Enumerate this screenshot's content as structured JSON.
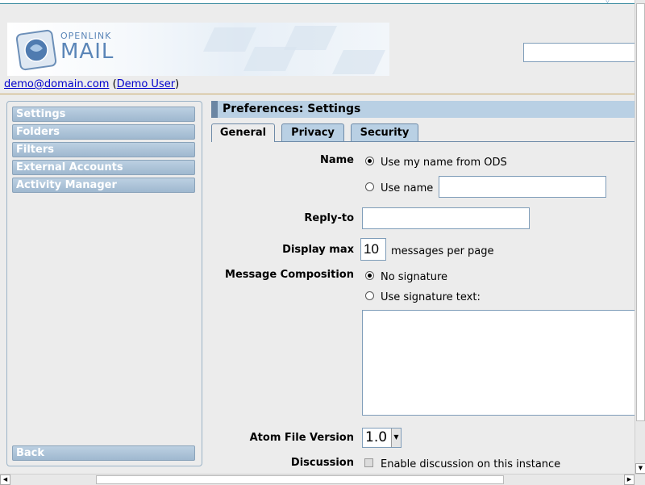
{
  "header": {
    "logo_line1": "OPENLINK",
    "logo_line2": "MAIL",
    "search_value": "",
    "user_email": "demo@domain.com",
    "user_name": "Demo User"
  },
  "sidebar": {
    "items": [
      {
        "label": "Settings"
      },
      {
        "label": "Folders"
      },
      {
        "label": "Filters"
      },
      {
        "label": "External Accounts"
      },
      {
        "label": "Activity Manager"
      }
    ],
    "back_label": "Back"
  },
  "content": {
    "title": "Preferences: Settings",
    "tabs": [
      {
        "label": "General",
        "active": true
      },
      {
        "label": "Privacy",
        "active": false
      },
      {
        "label": "Security",
        "active": false
      }
    ]
  },
  "form": {
    "name_label": "Name",
    "name_option_ods": "Use my name from ODS",
    "name_option_custom": "Use name",
    "name_value": "",
    "replyto_label": "Reply-to",
    "replyto_value": "",
    "display_max_label": "Display max",
    "display_max_value": "10",
    "display_max_suffix": "messages per page",
    "composition_label": "Message Composition",
    "composition_no_signature": "No signature",
    "composition_signature_text": "Use signature text:",
    "signature_value": "",
    "atom_label": "Atom File Version",
    "atom_value": "1.0",
    "discussion_label": "Discussion",
    "discussion_checkbox": "Enable discussion on this instance"
  },
  "colors": {
    "nav_button": "#a9c0d6",
    "title_bar": "#b9d0e4",
    "link": "#0000cc"
  }
}
